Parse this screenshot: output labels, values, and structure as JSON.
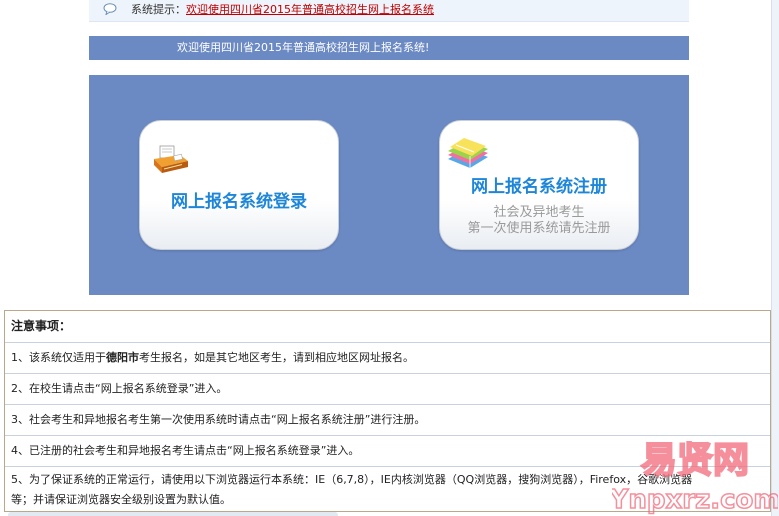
{
  "notice": {
    "label": "系统提示：",
    "message": "欢迎使用四川省2015年普通高校招生网上报名系统"
  },
  "welcome": {
    "text": "欢迎使用四川省2015年普通高校招生网上报名系统!"
  },
  "cards": {
    "login": {
      "title": "网上报名系统登录"
    },
    "register": {
      "title": "网上报名系统注册",
      "sub_line1": "社会及异地考生",
      "sub_line2": "第一次使用系统请先注册"
    }
  },
  "notes": {
    "heading": "注意事项：",
    "item1_pre": "1、该系统仅适用于",
    "item1_city": "德阳市",
    "item1_post": "考生报名，如是其它地区考生，请到相应地区网址报名。",
    "item2": "2、在校生请点击“网上报名系统登录”进入。",
    "item3": "3、社会考生和异地报名考生第一次使用系统时请点击“网上报名系统注册”进行注册。",
    "item4": "4、已注册的社会考生和异地报名考生请点击“网上报名系统登录”进入。",
    "item5_line1": "5、为了保证系统的正常运行，请使用以下浏览器运行本系统：IE（6,7,8），IE内核浏览器（QQ浏览器，搜狗浏览器），Firefox，谷歌浏览器",
    "item5_line2": "等；并请保证浏览器安全级别设置为默认值。"
  },
  "watermark": {
    "line1": "易贤网",
    "line2": "Ynpxrz.com"
  },
  "colors": {
    "blue_panel": "#6b89c3",
    "card_title": "#1e86d8",
    "notice_link": "#c00000",
    "watermark": "#f26a7a"
  },
  "icons": {
    "notice": "speech-bubble-icon",
    "login": "printer-icon",
    "register": "books-icon"
  }
}
